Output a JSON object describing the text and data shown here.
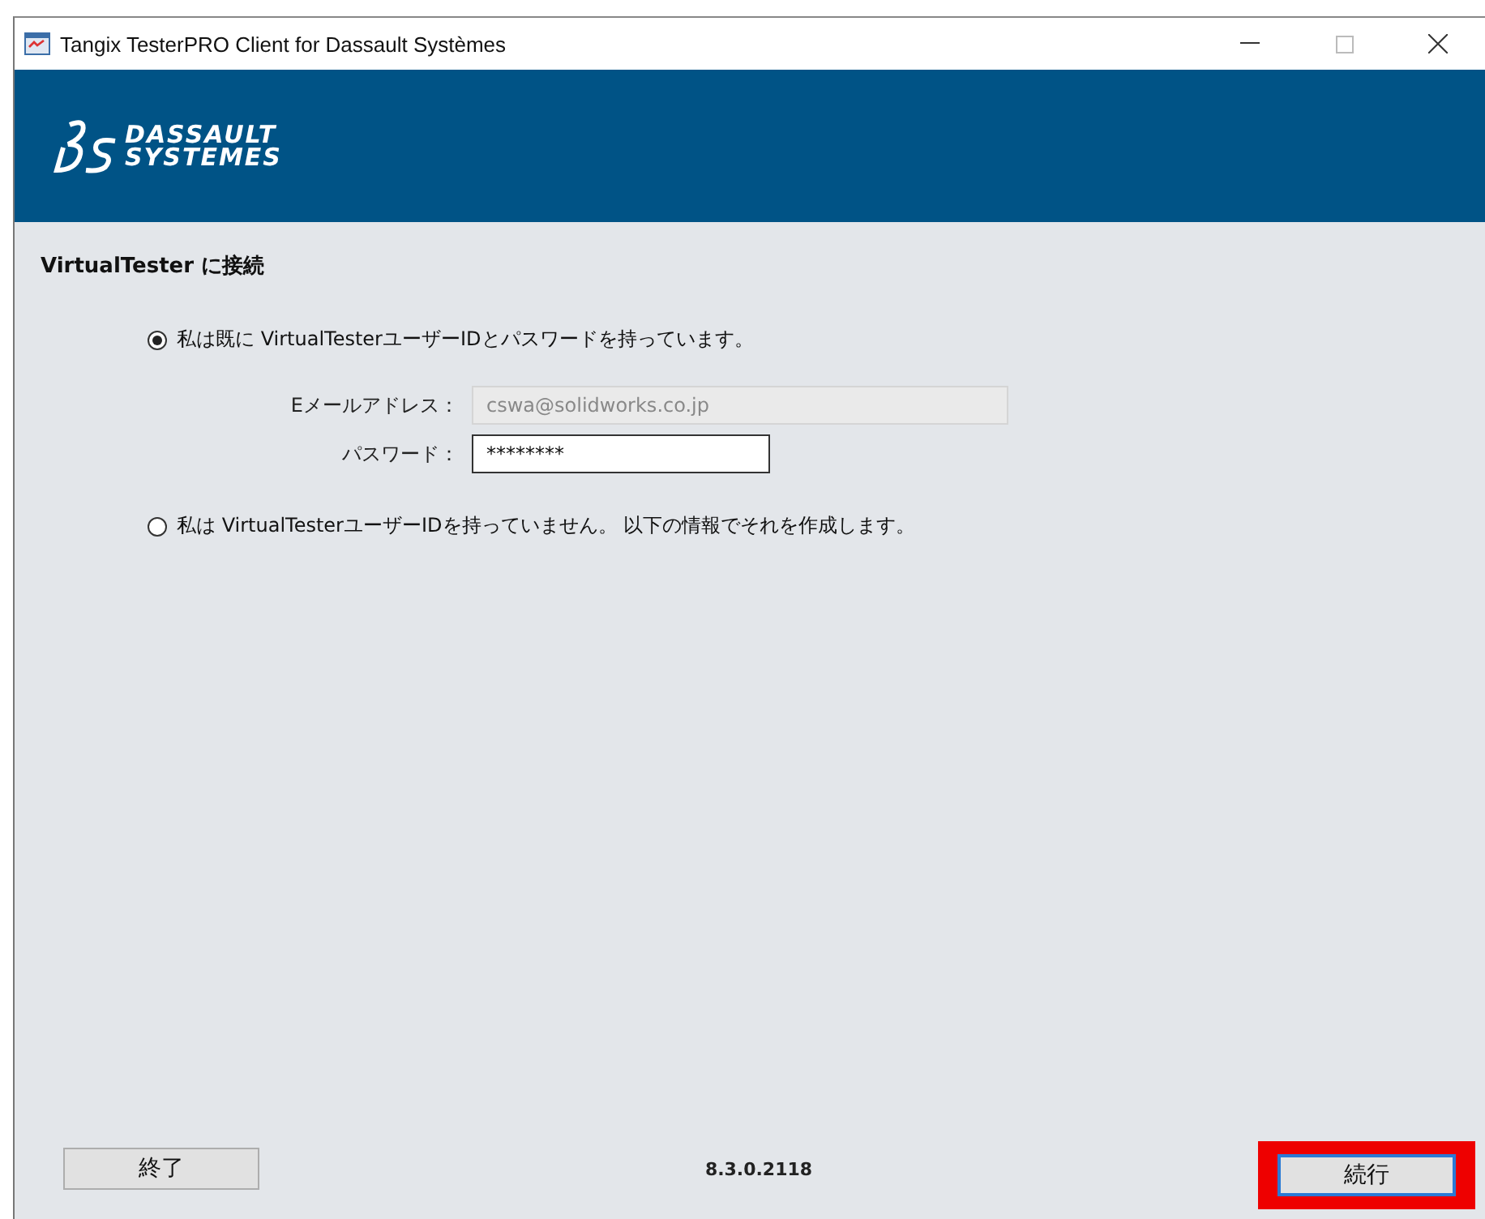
{
  "window": {
    "title": "Tangix TesterPRO Client for Dassault Systèmes"
  },
  "logo": {
    "line_1": "DASSAULT",
    "line_2": "SYSTEMES"
  },
  "heading": "VirtualTester に接続",
  "options": [
    {
      "label": "私は既に VirtualTesterユーザーIDとパスワードを持っています。",
      "selected": true
    },
    {
      "label": "私は VirtualTesterユーザーIDを持っていません。 以下の情報でそれを作成します。",
      "selected": false
    }
  ],
  "fields": [
    {
      "label": "Eメールアドレス：",
      "value": "cswa@solidworks.co.jp",
      "disabled": true
    },
    {
      "label": "パスワード：",
      "value": "********",
      "disabled": false
    }
  ],
  "footer": {
    "quit_button": "終了",
    "version": "8.3.0.2118",
    "continue_button": {
      "label": "続行",
      "highlighted": true
    }
  }
}
